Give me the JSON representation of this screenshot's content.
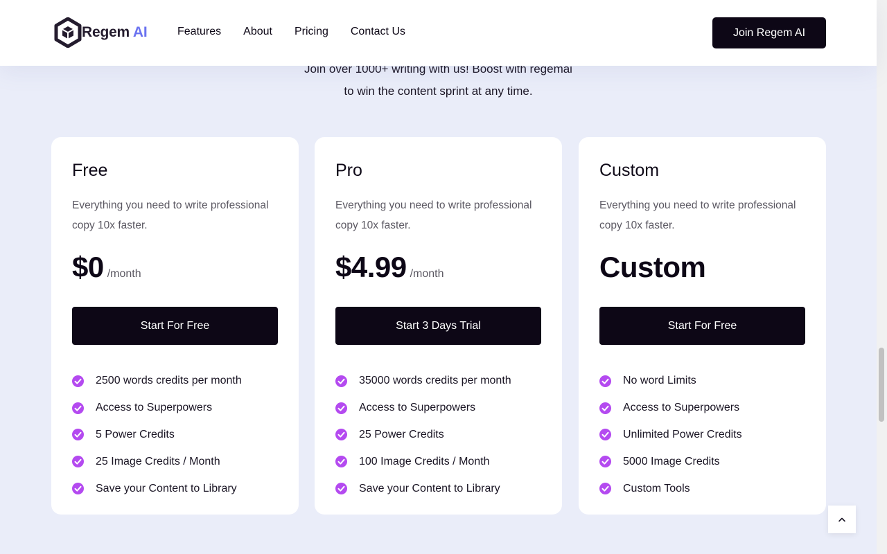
{
  "header": {
    "logo_text": "Regem",
    "logo_accent": "AI",
    "nav": [
      "Features",
      "About",
      "Pricing",
      "Contact Us"
    ],
    "cta_label": "Join Regem AI"
  },
  "intro": {
    "line1": "Join over 1000+ writing with us! Boost with regemai",
    "line2": "to win the content sprint at any time."
  },
  "plans": [
    {
      "name": "Free",
      "description": "Everything you need to write professional copy 10x faster.",
      "price": "$0",
      "period": "/month",
      "cta": "Start For Free",
      "features": [
        "2500 words credits per month",
        "Access to Superpowers",
        "5 Power Credits",
        "25 Image Credits / Month",
        "Save your Content to Library"
      ]
    },
    {
      "name": "Pro",
      "description": "Everything you need to write professional copy 10x faster.",
      "price": "$4.99",
      "period": "/month",
      "cta": "Start 3 Days Trial",
      "features": [
        "35000 words credits per month",
        "Access to Superpowers",
        "25 Power Credits",
        "100 Image Credits / Month",
        "Save your Content to Library"
      ]
    },
    {
      "name": "Custom",
      "description": "Everything you need to write professional copy 10x faster.",
      "price": "Custom",
      "period": "",
      "cta": "Start For Free",
      "features": [
        "No word Limits",
        "Access to Superpowers",
        "Unlimited Power Credits",
        "5000 Image Credits",
        "Custom Tools"
      ]
    }
  ],
  "icons": {
    "logo": "hexagon-cube-logo-icon",
    "feature": "check-circle-icon",
    "back_to_top": "chevron-up-icon"
  },
  "colors": {
    "background": "#eaedf9",
    "primary_dark": "#0d0716",
    "accent_blue": "#6b73f0",
    "check_purple": "#b44af0"
  }
}
